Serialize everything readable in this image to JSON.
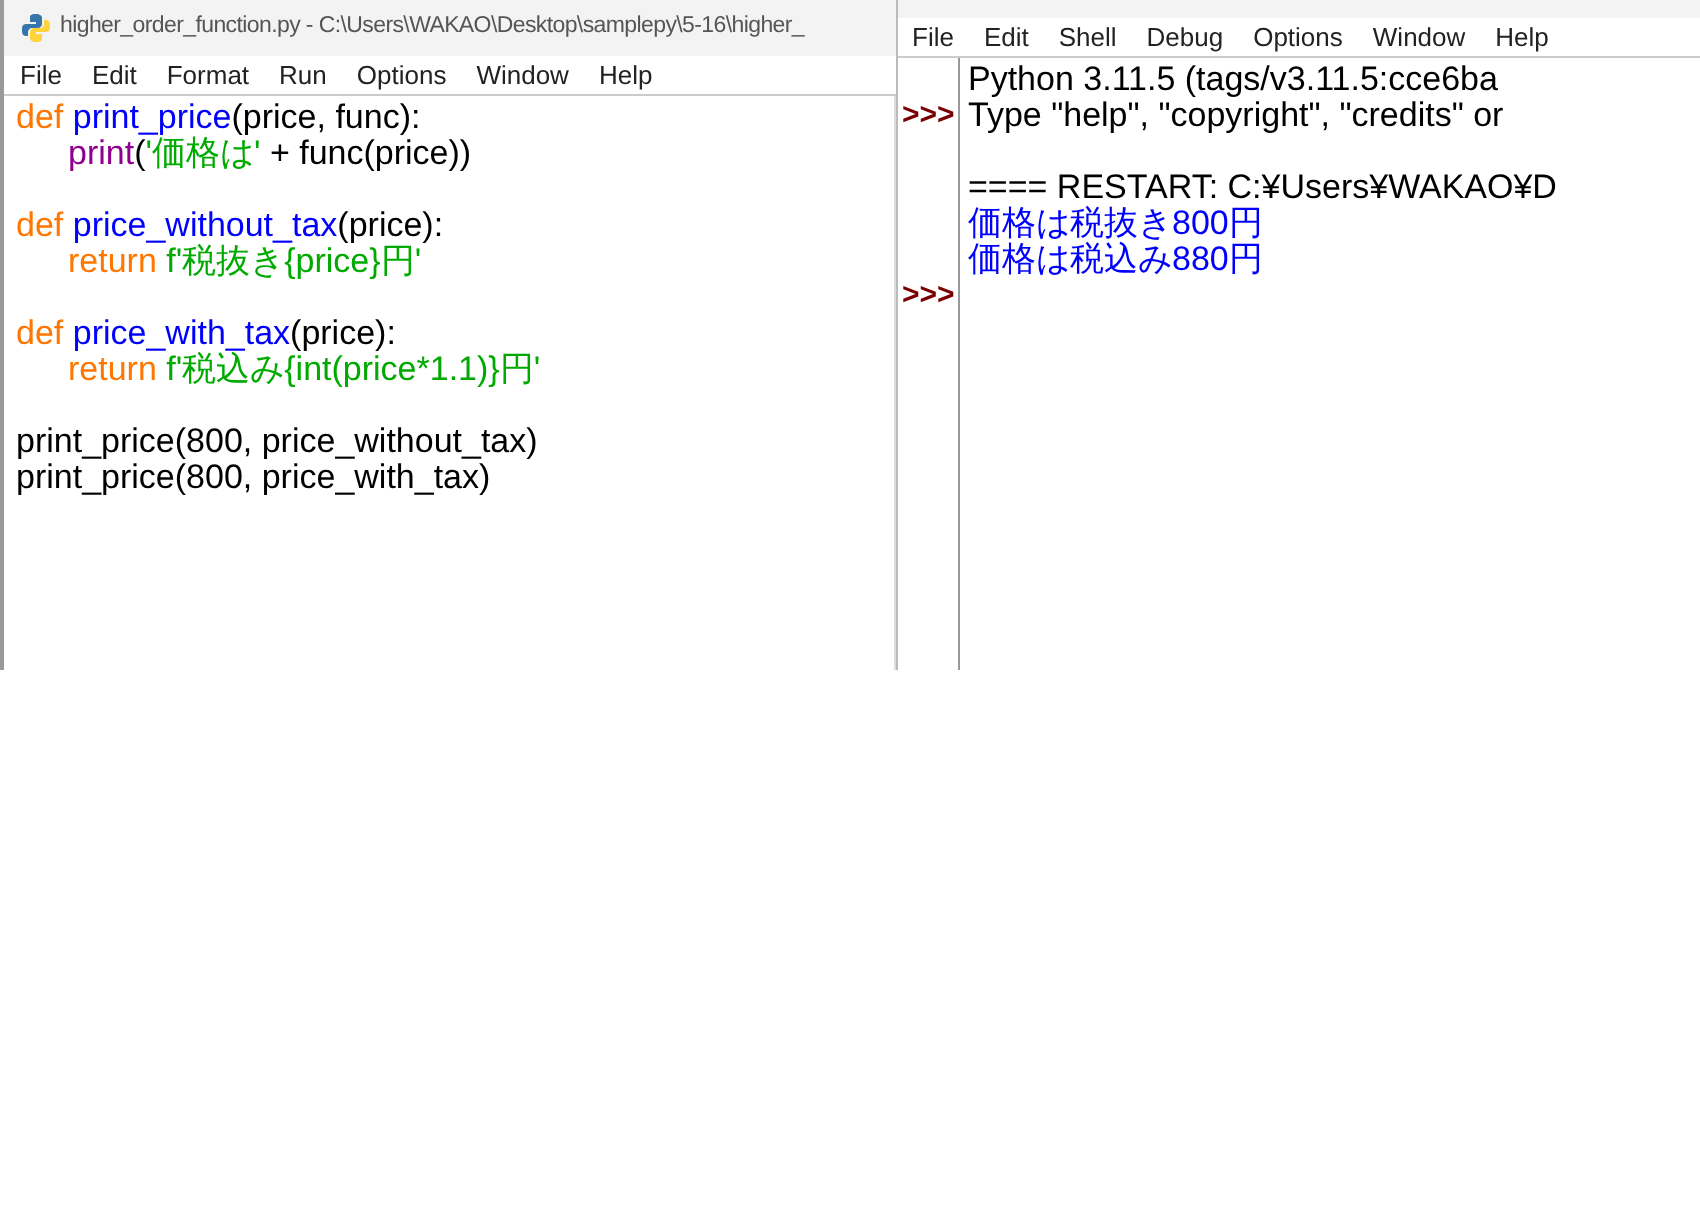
{
  "editor": {
    "title": "higher_order_function.py - C:\\Users\\WAKAO\\Desktop\\samplepy\\5-16\\higher_",
    "menu": [
      "File",
      "Edit",
      "Format",
      "Run",
      "Options",
      "Window",
      "Help"
    ],
    "blocks": [
      [
        {
          "indent": false,
          "tokens": [
            {
              "kind": "keyword",
              "text": "def"
            },
            {
              "kind": "name",
              "text": " print_price"
            },
            {
              "kind": "plain",
              "text": "(price, func):"
            }
          ]
        },
        {
          "indent": true,
          "tokens": [
            {
              "kind": "builtin",
              "text": "print"
            },
            {
              "kind": "plain",
              "text": "("
            },
            {
              "kind": "string",
              "text": "'価格は'"
            },
            {
              "kind": "plain",
              "text": " + func(price))"
            }
          ]
        }
      ],
      [
        {
          "indent": false,
          "tokens": [
            {
              "kind": "keyword",
              "text": "def"
            },
            {
              "kind": "name",
              "text": " price_without_tax"
            },
            {
              "kind": "plain",
              "text": "(price):"
            }
          ]
        },
        {
          "indent": true,
          "tokens": [
            {
              "kind": "keyword",
              "text": "return"
            },
            {
              "kind": "string",
              "text": " f'税抜き{price}円'"
            }
          ]
        }
      ],
      [
        {
          "indent": false,
          "tokens": [
            {
              "kind": "keyword",
              "text": "def"
            },
            {
              "kind": "name",
              "text": " price_with_tax"
            },
            {
              "kind": "plain",
              "text": "(price):"
            }
          ]
        },
        {
          "indent": true,
          "tokens": [
            {
              "kind": "keyword",
              "text": "return"
            },
            {
              "kind": "string",
              "text": " f'税込み{int(price*1.1)}円'"
            }
          ]
        }
      ],
      [
        {
          "indent": false,
          "tokens": [
            {
              "kind": "plain",
              "text": "print_price(800, price_without_tax)"
            }
          ]
        },
        {
          "indent": false,
          "tokens": [
            {
              "kind": "plain",
              "text": "print_price(800, price_with_tax)"
            }
          ]
        }
      ]
    ]
  },
  "shell": {
    "menu": [
      "File",
      "Edit",
      "Shell",
      "Debug",
      "Options",
      "Window",
      "Help"
    ],
    "lines": [
      {
        "kind": "banner",
        "text": "Python 3.11.5 (tags/v3.11.5:cce6ba"
      },
      {
        "kind": "banner",
        "prompt": ">>>",
        "text": "Type \"help\", \"copyright\", \"credits\" or"
      },
      {
        "kind": "blank"
      },
      {
        "kind": "banner",
        "text": "==== RESTART: C:¥Users¥WAKAO¥D"
      },
      {
        "kind": "output",
        "text": "価格は税抜き800円"
      },
      {
        "kind": "output",
        "text": "価格は税込み880円"
      },
      {
        "kind": "blank",
        "prompt": ">>>"
      }
    ]
  }
}
